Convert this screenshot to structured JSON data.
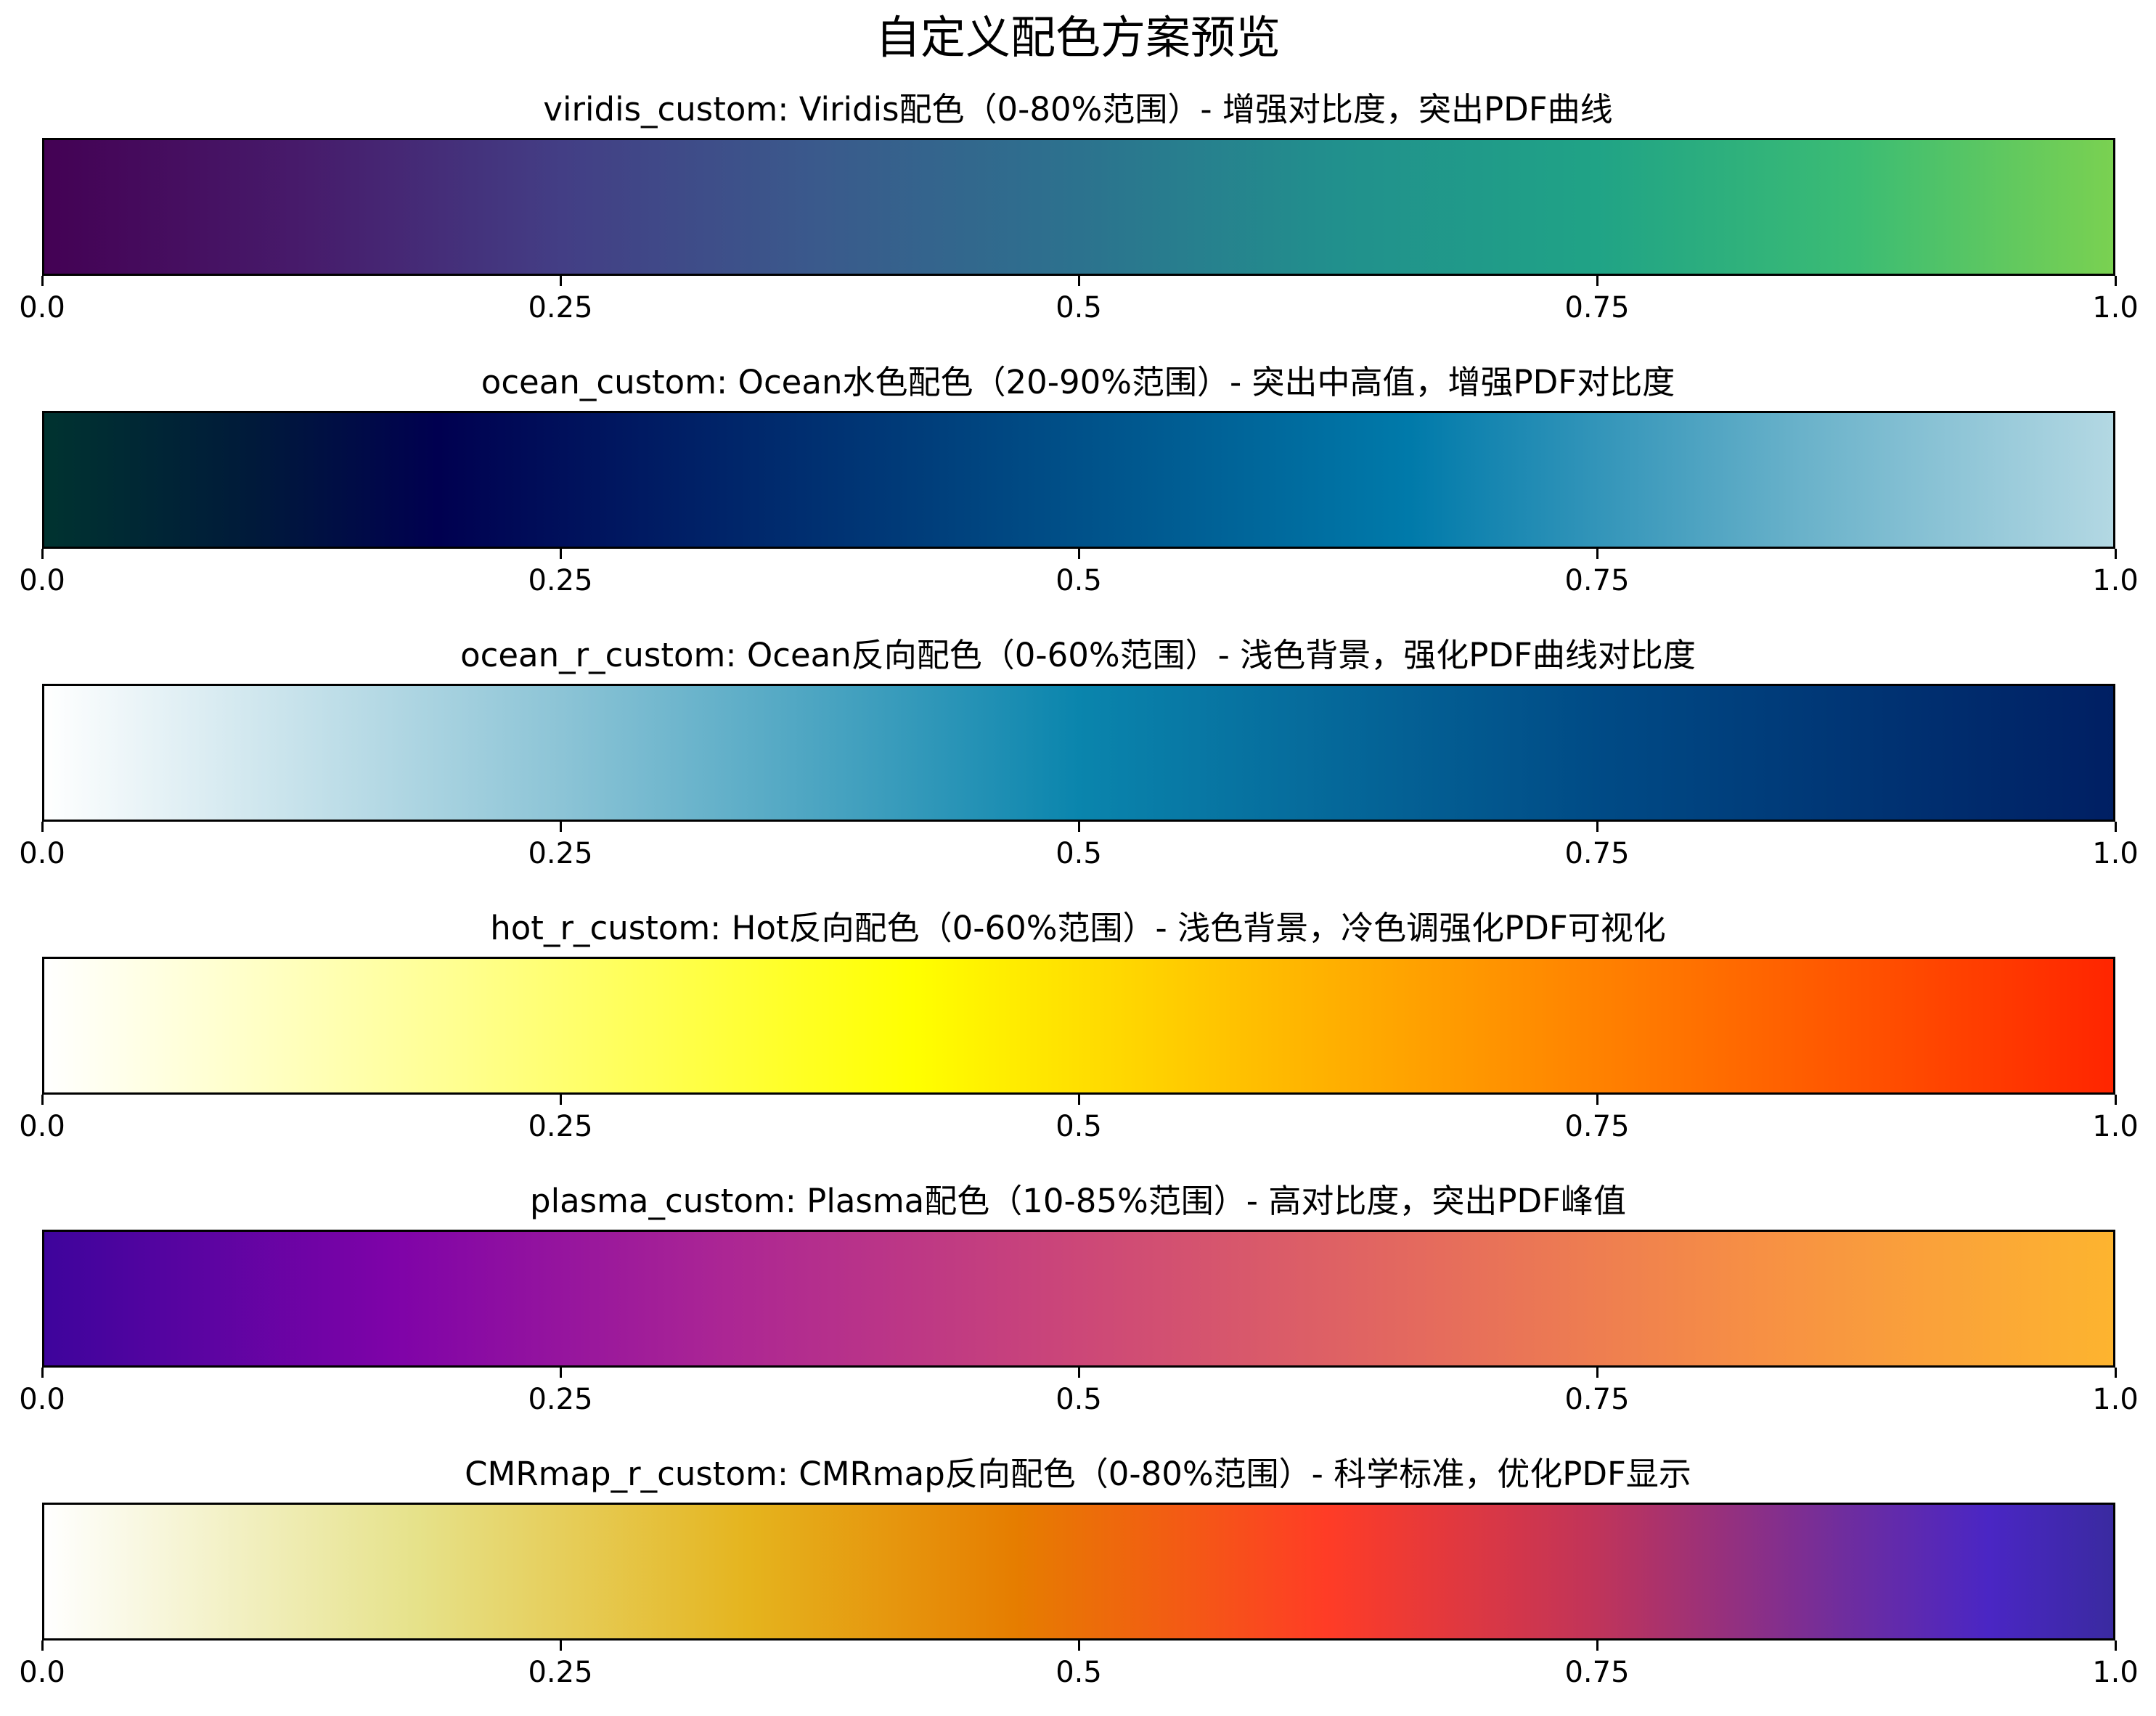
{
  "chart_data": {
    "type": "colorbar",
    "title": "自定义配色方案预览",
    "xlim": [
      0.0,
      1.0
    ],
    "ticks": [
      {
        "value": 0.0,
        "label": "0.0"
      },
      {
        "value": 0.25,
        "label": "0.25"
      },
      {
        "value": 0.5,
        "label": "0.5"
      },
      {
        "value": 0.75,
        "label": "0.75"
      },
      {
        "value": 1.0,
        "label": "1.0"
      }
    ],
    "colorbars": [
      {
        "id": "viridis",
        "title": "viridis_custom: Viridis配色（0-80%范围）- 增强对比度，突出PDF曲线",
        "stops": [
          {
            "pos": 0.0,
            "color": "#440154"
          },
          {
            "pos": 0.125,
            "color": "#471b6b"
          },
          {
            "pos": 0.25,
            "color": "#433e85"
          },
          {
            "pos": 0.375,
            "color": "#3a5a8c"
          },
          {
            "pos": 0.5,
            "color": "#2c728e"
          },
          {
            "pos": 0.625,
            "color": "#21908d"
          },
          {
            "pos": 0.75,
            "color": "#20a386"
          },
          {
            "pos": 0.875,
            "color": "#3bbc74"
          },
          {
            "pos": 1.0,
            "color": "#7ad151"
          }
        ]
      },
      {
        "id": "ocean",
        "title": "ocean_custom: Ocean水色配色（20-90%范围）- 突出中高值，增强PDF对比度",
        "stops": [
          {
            "pos": 0.0,
            "color": "#003330"
          },
          {
            "pos": 0.1,
            "color": "#001a3a"
          },
          {
            "pos": 0.19,
            "color": "#000050"
          },
          {
            "pos": 0.45,
            "color": "#00447f"
          },
          {
            "pos": 0.66,
            "color": "#007aaa"
          },
          {
            "pos": 0.85,
            "color": "#6ab2ca"
          },
          {
            "pos": 1.0,
            "color": "#b3d8e3"
          }
        ]
      },
      {
        "id": "ocean_r",
        "title": "ocean_r_custom: Ocean反向配色（0-60%范围）- 浅色背景，强化PDF曲线对比度",
        "stops": [
          {
            "pos": 0.0,
            "color": "#ffffff"
          },
          {
            "pos": 0.25,
            "color": "#8cc4d6"
          },
          {
            "pos": 0.5,
            "color": "#0a85ad"
          },
          {
            "pos": 0.75,
            "color": "#004b86"
          },
          {
            "pos": 1.0,
            "color": "#001f63"
          }
        ]
      },
      {
        "id": "hot_r",
        "title": "hot_r_custom: Hot反向配色（0-60%范围）- 浅色背景，冷色调强化PDF可视化",
        "stops": [
          {
            "pos": 0.0,
            "color": "#ffffff"
          },
          {
            "pos": 0.2,
            "color": "#ffff90"
          },
          {
            "pos": 0.42,
            "color": "#ffff00"
          },
          {
            "pos": 0.6,
            "color": "#ffb800"
          },
          {
            "pos": 0.8,
            "color": "#ff7000"
          },
          {
            "pos": 1.0,
            "color": "#ff2500"
          }
        ]
      },
      {
        "id": "plasma",
        "title": "plasma_custom: Plasma配色（10-85%范围）- 高对比度，突出PDF峰值",
        "stops": [
          {
            "pos": 0.0,
            "color": "#3e049c"
          },
          {
            "pos": 0.17,
            "color": "#7f03a8"
          },
          {
            "pos": 0.33,
            "color": "#ac2694"
          },
          {
            "pos": 0.5,
            "color": "#cc4778"
          },
          {
            "pos": 0.67,
            "color": "#e56b5d"
          },
          {
            "pos": 0.83,
            "color": "#f79044"
          },
          {
            "pos": 1.0,
            "color": "#fdb42f"
          }
        ]
      },
      {
        "id": "CMRmap_r",
        "title": "CMRmap_r_custom: CMRmap反向配色（0-80%范围）- 科学标准，优化PDF显示",
        "stops": [
          {
            "pos": 0.0,
            "color": "#ffffff"
          },
          {
            "pos": 0.18,
            "color": "#e6e28a"
          },
          {
            "pos": 0.34,
            "color": "#e5b41e"
          },
          {
            "pos": 0.47,
            "color": "#e67d00"
          },
          {
            "pos": 0.62,
            "color": "#ff3c26"
          },
          {
            "pos": 0.75,
            "color": "#c0345a"
          },
          {
            "pos": 0.87,
            "color": "#6f2d9e"
          },
          {
            "pos": 0.94,
            "color": "#4a26c4"
          },
          {
            "pos": 1.0,
            "color": "#3a2aa0"
          }
        ]
      }
    ]
  }
}
